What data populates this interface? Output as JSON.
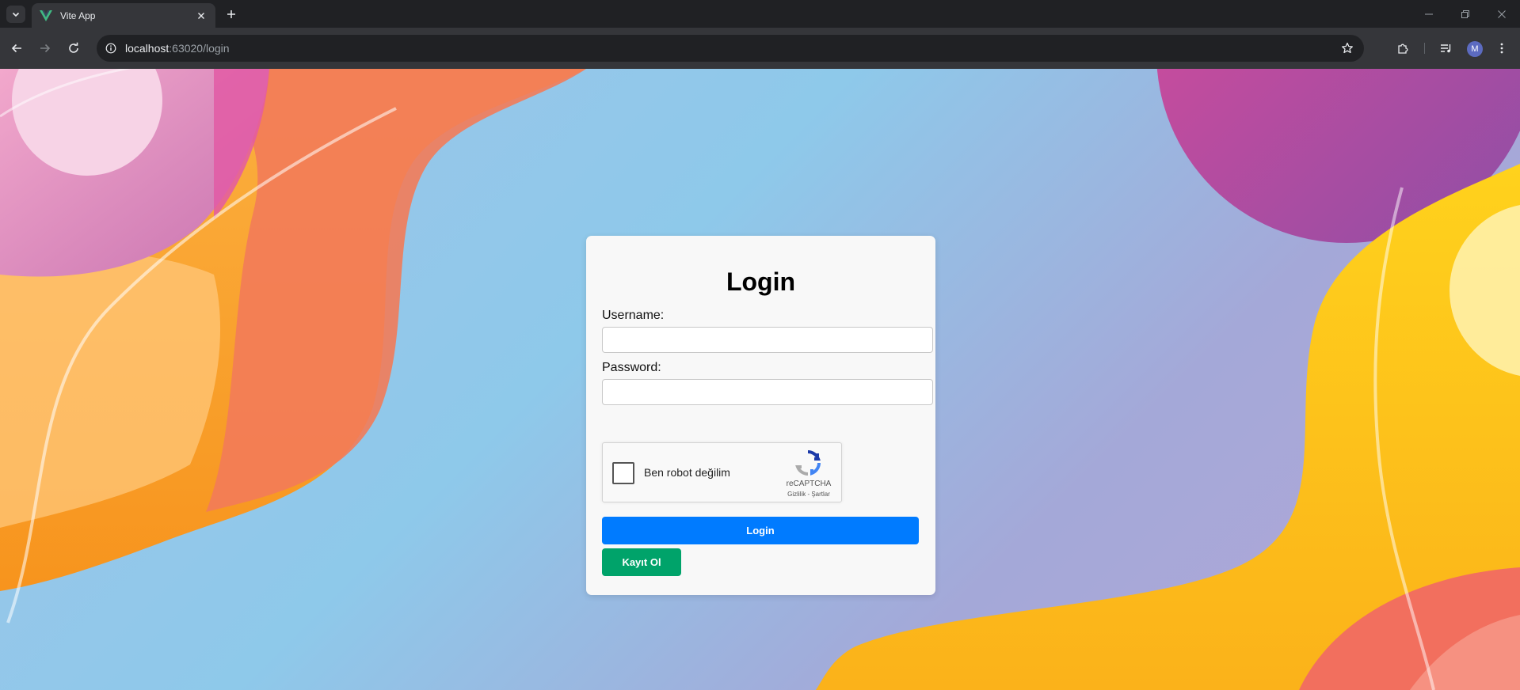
{
  "browser": {
    "tab_title": "Vite App",
    "url_host": "localhost",
    "url_path": ":63020/login",
    "profile_initial": "M",
    "icons": {
      "tab_search": "chevron-down-icon",
      "favicon": "vue-logo-icon",
      "tab_close": "close-icon",
      "new_tab": "plus-icon",
      "back": "arrow-left-icon",
      "forward": "arrow-right-icon",
      "reload": "reload-icon",
      "site_info": "info-icon",
      "bookmark": "star-icon",
      "extensions": "puzzle-icon",
      "media": "playlist-icon",
      "menu": "kebab-menu-icon",
      "minimize": "minimize-icon",
      "restore": "restore-icon",
      "close_window": "close-icon"
    }
  },
  "login": {
    "title": "Login",
    "username_label": "Username:",
    "username_value": "",
    "password_label": "Password:",
    "password_value": "",
    "recaptcha": {
      "checkbox_label": "Ben robot değilim",
      "brand": "reCAPTCHA",
      "terms": "Gizlilik - Şartlar"
    },
    "login_button": "Login",
    "register_button": "Kayıt Ol"
  },
  "colors": {
    "login_button": "#007bff",
    "register_button": "#00a36a",
    "card_bg": "#f8f8f8",
    "chrome_dark": "#202124",
    "chrome_toolbar": "#35363a"
  }
}
